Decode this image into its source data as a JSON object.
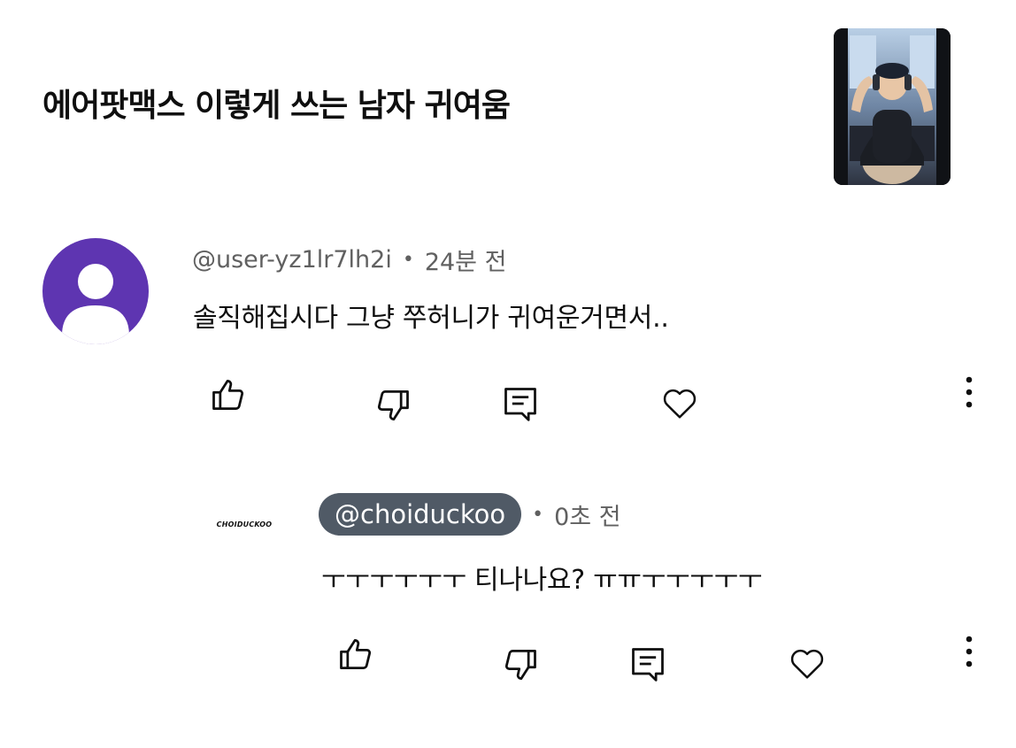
{
  "video": {
    "title": "에어팟맥스 이렇게 쓰는 남자 귀여움"
  },
  "comments": [
    {
      "author": "@user-yz1lr7lh2i",
      "separator": "•",
      "time": "24분 전",
      "text": "솔직해집시다 그냥 쭈허니가 귀여운거면서..",
      "avatar_color": "#5e35b1"
    },
    {
      "author": "@choiduckoo",
      "separator": "•",
      "time": "0초 전",
      "text": "ㅜㅜㅜㅜㅜㅜ 티나나요? ㅠㅠㅜㅜㅜㅜㅜ",
      "avatar_text": "CHOIDUCKOO",
      "author_pill_color": "#505a66"
    }
  ],
  "icons": {
    "like": "thumbs-up-icon",
    "dislike": "thumbs-down-icon",
    "reply": "reply-icon",
    "heart": "heart-icon",
    "more": "more-vertical-icon"
  }
}
